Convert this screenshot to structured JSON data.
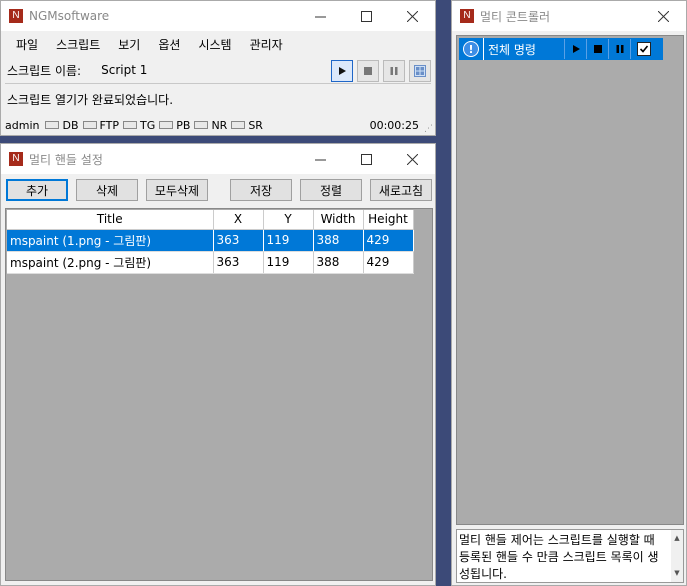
{
  "main_window": {
    "title": "NGMsoftware",
    "menu": [
      "파일",
      "스크립트",
      "보기",
      "옵션",
      "시스템",
      "관리자"
    ],
    "script_label": "스크립트 이름:",
    "script_name": "Script 1",
    "status_message": "스크립트 열기가 완료되었습니다.",
    "statusbar": {
      "user": "admin",
      "indicators": [
        "DB",
        "FTP",
        "TG",
        "PB",
        "NR",
        "SR"
      ],
      "time": "00:00:25"
    }
  },
  "handle_window": {
    "title": "멀티 핸들 설정",
    "buttons": {
      "add": "추가",
      "delete": "삭제",
      "delete_all": "모두삭제",
      "save": "저장",
      "sort": "정렬",
      "refresh": "새로고침"
    },
    "columns": [
      "Title",
      "X",
      "Y",
      "Width",
      "Height"
    ],
    "rows": [
      {
        "title": "mspaint (1.png - 그림판)",
        "x": "363",
        "y": "119",
        "width": "388",
        "height": "429",
        "selected": true
      },
      {
        "title": "mspaint (2.png - 그림판)",
        "x": "363",
        "y": "119",
        "width": "388",
        "height": "429",
        "selected": false
      }
    ]
  },
  "controller_window": {
    "title": "멀티 콘트롤러",
    "command_label": "전체 명령",
    "warn_icon": "!",
    "description": "멀티 핸들 제어는 스크립트를 실행할 때 등록된 핸들 수 만큼 스크립트 목록이 생성됩니다."
  },
  "colors": {
    "selection": "#0078d7",
    "app_icon": "#a52a1a",
    "workspace": "#ababab"
  }
}
